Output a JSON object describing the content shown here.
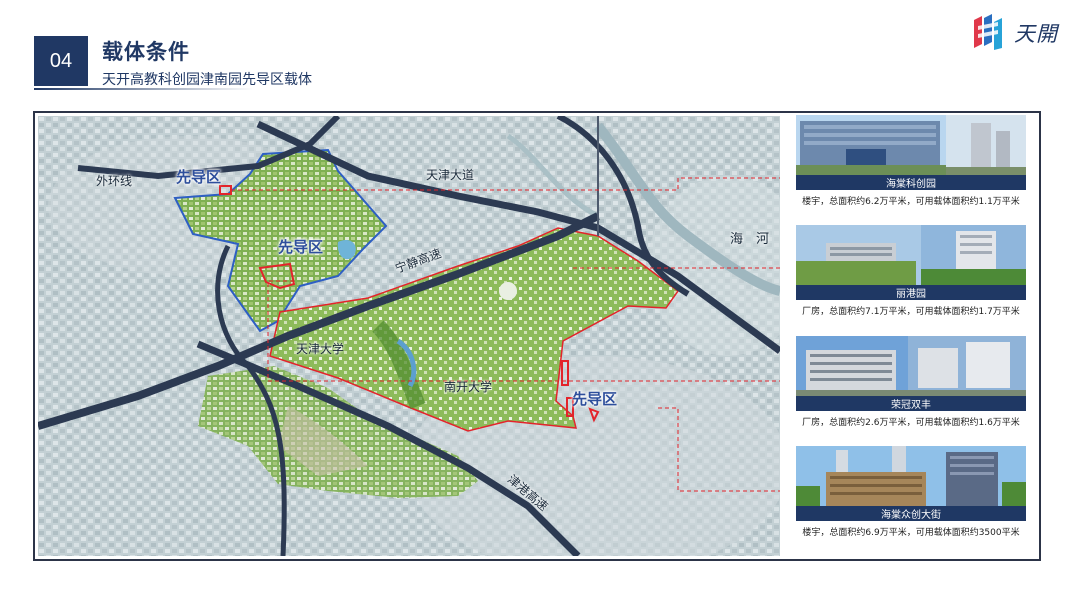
{
  "header": {
    "section_number": "04",
    "title": "载体条件",
    "subtitle": "天开高教科创园津南园先导区载体"
  },
  "logo": {
    "text": "天開"
  },
  "map": {
    "roads": {
      "outer_ring": "外环线",
      "tianjin_avenue": "天津大道",
      "ningjing": "宁静高速",
      "jingang": "津港高速",
      "river": "海　河"
    },
    "pilot_zone_label": "先导区",
    "universities": {
      "tju": "天津大学",
      "nku": "南开大学"
    }
  },
  "carriers": [
    {
      "name": "海棠科创园",
      "desc": "楼宇，总面积约6.2万平米，可用载体面积约1.1万平米"
    },
    {
      "name": "丽港园",
      "desc": "厂房，总面积约7.1万平米，可用载体面积约1.7万平米"
    },
    {
      "name": "荣冠双丰",
      "desc": "厂房，总面积约2.6万平米，可用载体面积约1.6万平米"
    },
    {
      "name": "海棠众创大街",
      "desc": "楼宇，总面积约6.9万平米，可用载体面积约3500平米"
    }
  ],
  "colors": {
    "navy": "#203864",
    "caption_bar": "#1f3864",
    "pilot_boundary": "#e3242b",
    "pilot_label": "#2e4f9c",
    "road": "#2c3a52"
  }
}
